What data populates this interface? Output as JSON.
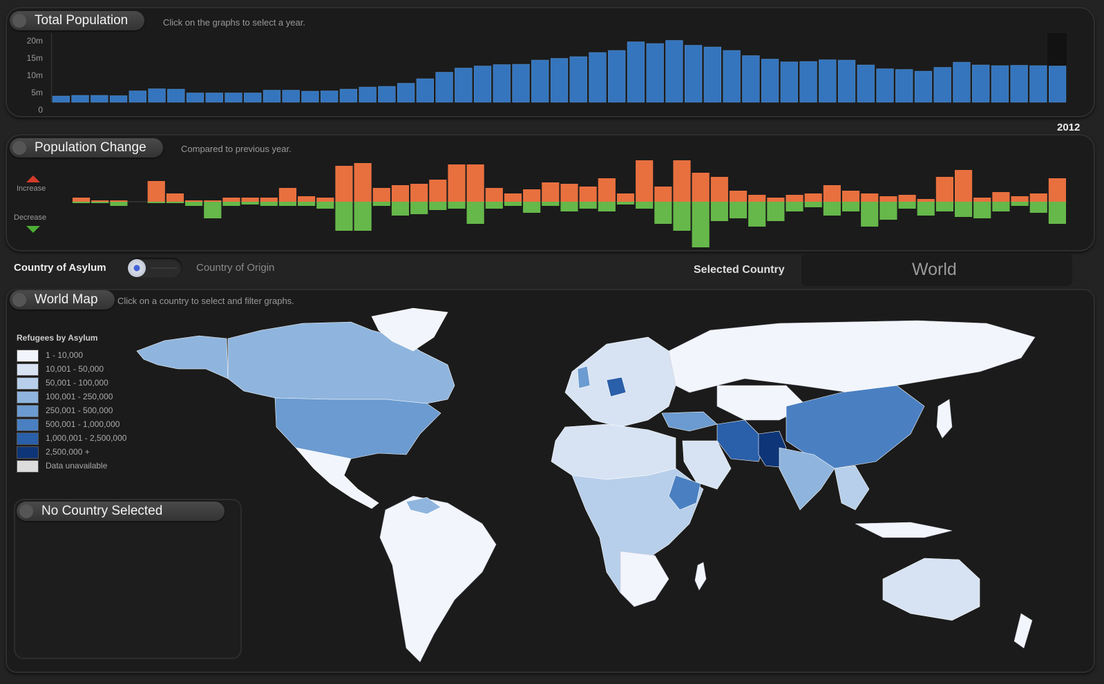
{
  "total_population": {
    "title": "Total Population",
    "hint": "Click on the graphs to select a year.",
    "y_ticks": [
      "20m",
      "15m",
      "10m",
      "5m",
      "0"
    ],
    "selected_year": "2012"
  },
  "population_change": {
    "title": "Population Change",
    "hint": "Compared to previous year.",
    "increase_label": "Increase",
    "decrease_label": "Decrease"
  },
  "toggle": {
    "left_label": "Country of Asylum",
    "right_label": "Country of Origin",
    "selected_country_label": "Selected Country",
    "selected_country_value": "World"
  },
  "world_map": {
    "title": "World Map",
    "hint": "Click on a country to select and filter graphs.",
    "legend_title": "Refugees by Asylum",
    "legend": [
      {
        "label": "1 - 10,000",
        "color": "#f2f5fb"
      },
      {
        "label": "10,001 - 50,000",
        "color": "#d7e3f3"
      },
      {
        "label": "50,001 - 100,000",
        "color": "#b7cfea"
      },
      {
        "label": "100,001 - 250,000",
        "color": "#8fb5de"
      },
      {
        "label": "250,001 - 500,000",
        "color": "#6b9bd0"
      },
      {
        "label": "500,001 - 1,000,000",
        "color": "#4a80c2"
      },
      {
        "label": "1,000,001 - 2,500,000",
        "color": "#2a5fa9"
      },
      {
        "label": "2,500,000 +",
        "color": "#0e3577"
      },
      {
        "label": "Data unavailable",
        "color": "#dcdcdc"
      }
    ]
  },
  "country_panel": {
    "title": "No Country Selected"
  },
  "colors": {
    "bar_blue": "#3575bd",
    "increase": "#e8703f",
    "decrease": "#66b84a",
    "increase_arrow": "#d33b2a",
    "decrease_arrow": "#4cae34"
  },
  "chart_data": [
    {
      "type": "bar",
      "title": "Total Population",
      "ylim": [
        0,
        20
      ],
      "unit": "m",
      "values": [
        1.8,
        2.0,
        2.0,
        1.9,
        3.3,
        3.9,
        3.8,
        2.7,
        2.7,
        2.7,
        2.7,
        3.5,
        3.5,
        3.2,
        3.3,
        3.8,
        4.4,
        4.6,
        5.5,
        6.8,
        8.7,
        9.9,
        10.5,
        10.9,
        11.0,
        12.2,
        12.7,
        13.2,
        14.4,
        15.0,
        17.5,
        17.0,
        17.9,
        16.5,
        16.0,
        15.0,
        13.5,
        12.5,
        11.7,
        11.8,
        12.3,
        12.2,
        10.8,
        9.7,
        9.5,
        9.0,
        10.1,
        11.6,
        10.8,
        10.6,
        10.7,
        10.6,
        10.5
      ],
      "selected_category": "2012"
    },
    {
      "type": "bar",
      "title": "Population Change",
      "increase": [
        0.3,
        0.1,
        0.1,
        0,
        1.5,
        0.6,
        0.1,
        0.1,
        0.3,
        0.3,
        0.3,
        1.0,
        0.4,
        0.3,
        2.6,
        2.8,
        1.0,
        1.2,
        1.3,
        1.6,
        2.7,
        2.7,
        1.0,
        0.6,
        0.9,
        1.4,
        1.3,
        1.1,
        1.7,
        0.6,
        3.0,
        1.1,
        3.0,
        2.1,
        1.8,
        0.8,
        0.5,
        0.3,
        0.5,
        0.6,
        1.2,
        0.8,
        0.6,
        0.4,
        0.5,
        0.2,
        1.8,
        2.3,
        0.3,
        0.7,
        0.4,
        0.6,
        1.7
      ],
      "decrease": [
        0.1,
        0.1,
        0.3,
        0,
        0.1,
        0.1,
        0.3,
        1.2,
        0.3,
        0.2,
        0.3,
        0.3,
        0.3,
        0.5,
        2.1,
        2.1,
        0.3,
        1.0,
        0.9,
        0.6,
        0.5,
        1.6,
        0.5,
        0.3,
        0.8,
        0.3,
        0.7,
        0.5,
        0.7,
        0.2,
        0.5,
        1.6,
        2.1,
        3.3,
        1.4,
        1.2,
        1.8,
        1.4,
        0.7,
        0.4,
        1.0,
        0.7,
        1.8,
        1.3,
        0.5,
        1.0,
        0.7,
        1.1,
        1.2,
        0.7,
        0.3,
        0.8,
        1.6
      ]
    }
  ]
}
